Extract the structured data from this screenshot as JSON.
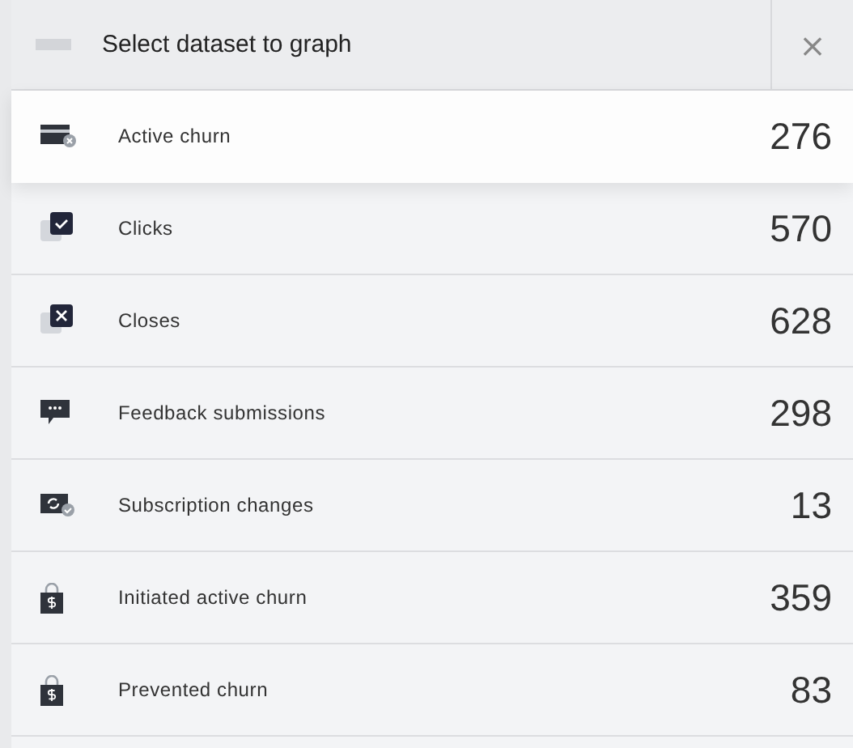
{
  "header": {
    "title": "Select dataset to graph",
    "close": "×"
  },
  "datasets": [
    {
      "label": "Active churn",
      "count": "276",
      "kind": "card",
      "selected": true
    },
    {
      "label": "Clicks",
      "count": "570",
      "kind": "check",
      "selected": false
    },
    {
      "label": "Closes",
      "count": "628",
      "kind": "close",
      "selected": false
    },
    {
      "label": "Feedback submissions",
      "count": "298",
      "kind": "chat",
      "selected": false
    },
    {
      "label": "Subscription changes",
      "count": "13",
      "kind": "sync",
      "selected": false
    },
    {
      "label": "Initiated active churn",
      "count": "359",
      "kind": "bag",
      "selected": false
    },
    {
      "label": "Prevented churn",
      "count": "83",
      "kind": "bag",
      "selected": false
    }
  ]
}
